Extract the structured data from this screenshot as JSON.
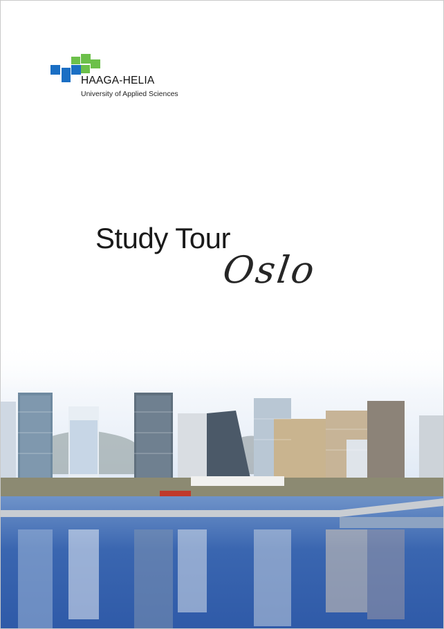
{
  "logo": {
    "name": "HAAGA-HELIA",
    "subtitle": "University of Applied Sciences",
    "colors": {
      "blue": "#1a6fc4",
      "green": "#6cc04a"
    }
  },
  "cover": {
    "title": "Study Tour",
    "subtitle": "Oslo"
  },
  "photo": {
    "description_icon": "city-skyline-photo",
    "colors": {
      "sky": "#dfe9f5",
      "water": "#3f6fb8",
      "reflection": "#9fb9e0"
    }
  }
}
